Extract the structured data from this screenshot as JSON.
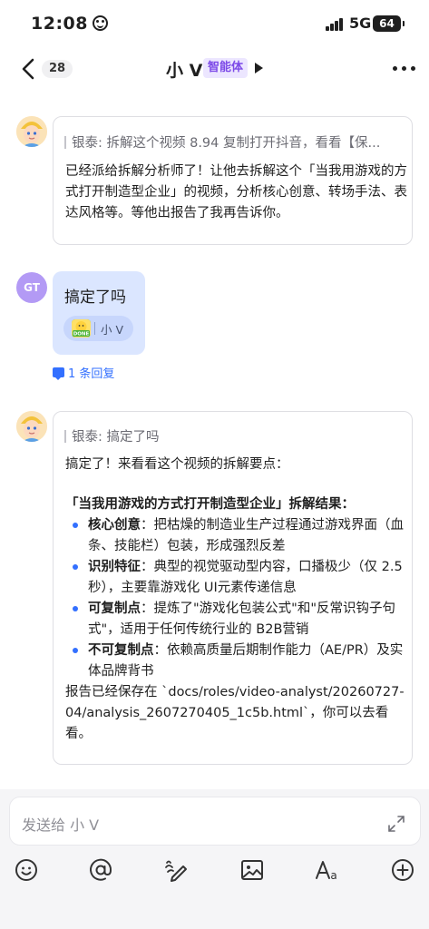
{
  "status_bar": {
    "time": "12:08",
    "network": "5G",
    "battery": "64"
  },
  "header": {
    "back_count": "28",
    "title": "小 V",
    "bot_tag": "智能体"
  },
  "messages": [
    {
      "sender": "bot",
      "quote": "银泰: 拆解这个视频 8.94 复制打开抖音，看看【保...",
      "text": "已经派给拆解分析师了！让他去拆解这个「当我用游戏的方式打开制造型企业」的视频，分析核心创意、转场手法、表达风格等。等他出报告了我再告诉你。"
    },
    {
      "sender": "user",
      "avatar_text": "GT",
      "text": "搞定了吗",
      "reaction_sticker_text": "DONE",
      "reaction_name": "小 V",
      "reply_link": "1 条回复"
    },
    {
      "sender": "bot",
      "quote": "银泰: 搞定了吗",
      "intro": "搞定了！来看看这个视频的拆解要点：",
      "heading": "「当我用游戏的方式打开制造型企业」拆解结果：",
      "points": [
        {
          "label": "核心创意",
          "text": "：把枯燥的制造业生产过程通过游戏界面（血条、技能栏）包装，形成强烈反差"
        },
        {
          "label": "识别特征",
          "text": "：典型的视觉驱动型内容，口播极少（仅 2.5秒），主要靠游戏化 UI元素传递信息"
        },
        {
          "label": "可复制点",
          "text": "：提炼了\"游戏化包装公式\"和\"反常识钩子句式\"，适用于任何传统行业的 B2B营销"
        },
        {
          "label": "不可复制点",
          "text": "：依赖高质量后期制作能力（AE/PR）及实体品牌背书"
        }
      ],
      "outro": "报告已经保存在 `docs/roles/video-analyst/20260727-04/analysis_2607270405_1c5b.html`，你可以去看看。"
    }
  ],
  "composer": {
    "placeholder": "发送给 小 V"
  },
  "toolbar": [
    "emoji-icon",
    "mention-icon",
    "handwrite-icon",
    "image-icon",
    "text-format-icon",
    "plus-icon"
  ]
}
